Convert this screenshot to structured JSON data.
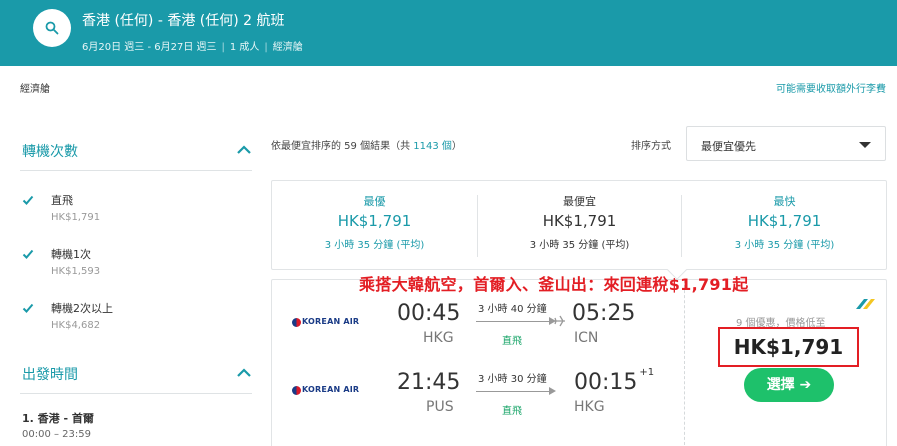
{
  "header": {
    "title": "香港 (任何) - 香港 (任何) 2 航班",
    "dates": "6月20日 週三 - 6月27日 週三",
    "passengers": "1 成人",
    "cabin": "經濟艙",
    "bg_color": "#1a9aa9"
  },
  "cabin_label": "經濟艙",
  "baggage_notice": "可能需要收取額外行李費",
  "sidebar": {
    "stops_title": "轉機次數",
    "stops": [
      {
        "label": "直飛",
        "price": "HK$1,791",
        "checked": true
      },
      {
        "label": "轉機1次",
        "price": "HK$1,593",
        "checked": true
      },
      {
        "label": "轉機2次以上",
        "price": "HK$4,682",
        "checked": true
      }
    ],
    "departure_title": "出發時間",
    "segment_title": "1. 香港 - 首爾",
    "segment_time": "00:00 – 23:59"
  },
  "results": {
    "prefix": "依",
    "sort_word": "最便宜",
    "middle": "排序的 59 個結果（共 ",
    "total": "1143 個",
    "suffix": "）"
  },
  "sort": {
    "label": "排序方式",
    "value": "最便宜優先"
  },
  "tabs": [
    {
      "label": "最優",
      "price": "HK$1,791",
      "duration": "3 小時 35 分鐘 (平均)",
      "active": false
    },
    {
      "label": "最便宜",
      "price": "HK$1,791",
      "duration": "3 小時 35 分鐘 (平均)",
      "active": true
    },
    {
      "label": "最快",
      "price": "HK$1,791",
      "duration": "3 小時 35 分鐘 (平均)",
      "active": false
    }
  ],
  "promo_text": "乘搭大韓航空，首爾入、釜山出：來回連稅$1,791起",
  "itinerary": {
    "legs": [
      {
        "airline": "KOREAN AIR",
        "dep_time": "00:45",
        "dep_code": "HKG",
        "duration": "3 小時 40 分鐘",
        "stops": "直飛",
        "arr_time": "05:25",
        "arr_code": "ICN",
        "day_offset": ""
      },
      {
        "airline": "KOREAN AIR",
        "dep_time": "21:45",
        "dep_code": "PUS",
        "duration": "3 小時 30 分鐘",
        "stops": "直飛",
        "arr_time": "00:15",
        "arr_code": "HKG",
        "day_offset": "+1"
      }
    ],
    "offers_text": "9 個優惠，價格低至",
    "price": "HK$1,791",
    "select_label": "選擇 ➔"
  }
}
